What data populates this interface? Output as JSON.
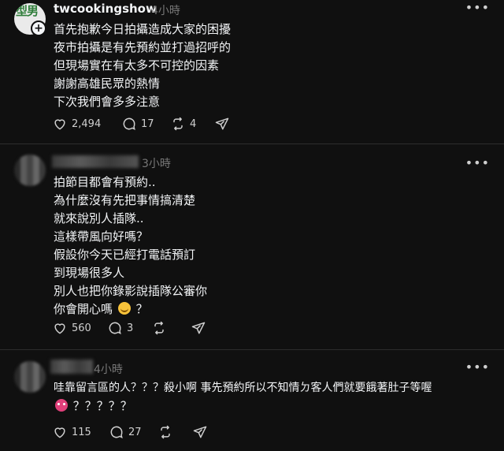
{
  "posts": [
    {
      "username": "twcookingshow",
      "time": "4小時",
      "avatar_text": "型男",
      "lines": [
        "首先抱歉今日拍攝造成大家的困擾",
        "夜市拍攝是有先預約並打過招呼的",
        "但現場實在有太多不可控的因素",
        "謝謝高雄民眾的熱情",
        "下次我們會多多注意"
      ],
      "likes": "2,494",
      "comments": "17",
      "reposts": "4"
    },
    {
      "username": "",
      "time": "3小時",
      "lines": [
        "拍節目都會有預約..",
        "為什麼沒有先把事情搞清楚",
        "就來說別人插隊..",
        "這樣帶風向好嗎？",
        "假設你今天已經打電話預訂",
        "到現場很多人",
        "別人也把你錄影說插隊公審你",
        "你會開心嗎 ",
        "？"
      ],
      "likes": "560",
      "comments": "3",
      "reposts": ""
    },
    {
      "username": "",
      "time": "4小時",
      "lines": [
        "哇靠留言區的人？？？殺小啊 事先預約所以不知情ㄉ客人們就要餓著肚子等喔",
        "？？？？？"
      ],
      "likes": "115",
      "comments": "27",
      "reposts": ""
    }
  ],
  "icons": {
    "more": "more-dots-icon",
    "like": "heart-icon",
    "comment": "comment-bubble-icon",
    "repost": "repost-icon",
    "share": "send-icon",
    "follow": "plus-icon"
  }
}
